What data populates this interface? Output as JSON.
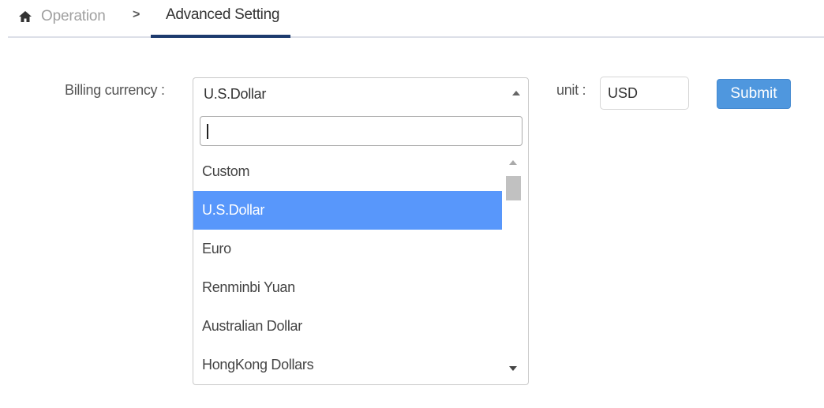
{
  "breadcrumb": {
    "home_icon": "home-icon",
    "parent": "Operation",
    "separator": ">",
    "current": "Advanced Setting"
  },
  "form": {
    "currency_label": "Billing currency :",
    "currency_selected": "U.S.Dollar",
    "unit_label": "unit :",
    "unit_value": "USD",
    "submit_label": "Submit"
  },
  "dropdown": {
    "search_value": "",
    "options": [
      {
        "label": "Custom",
        "selected": false
      },
      {
        "label": "U.S.Dollar",
        "selected": true
      },
      {
        "label": "Euro",
        "selected": false
      },
      {
        "label": "Renminbi Yuan",
        "selected": false
      },
      {
        "label": "Australian Dollar",
        "selected": false
      },
      {
        "label": "HongKong Dollars",
        "selected": false
      }
    ]
  },
  "colors": {
    "accent": "#4f97de",
    "selected_option": "#5897fb",
    "breadcrumb_underline": "#1d3b6e"
  }
}
